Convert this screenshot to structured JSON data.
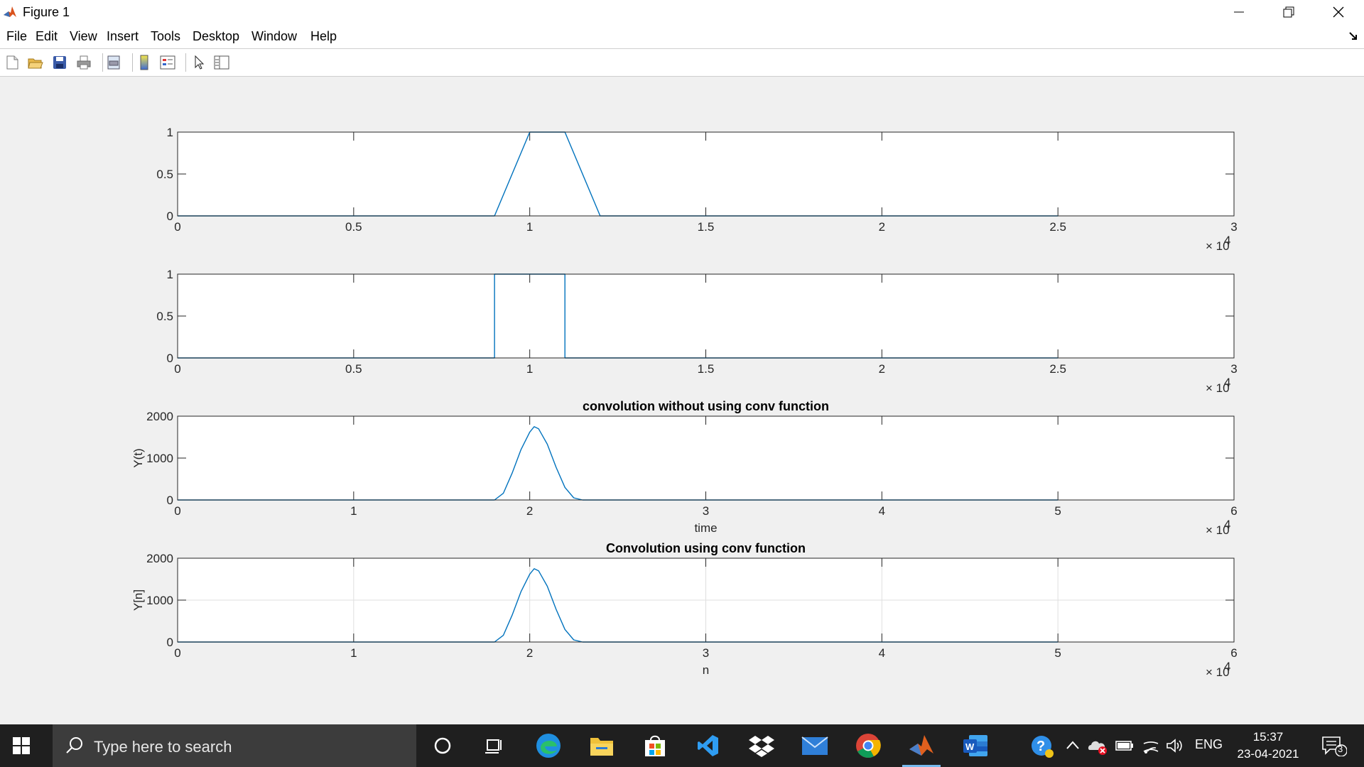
{
  "window": {
    "title": "Figure 1"
  },
  "menu": {
    "items": [
      "File",
      "Edit",
      "View",
      "Insert",
      "Tools",
      "Desktop",
      "Window",
      "Help"
    ]
  },
  "toolbar": {
    "buttons": [
      "new-figure",
      "open-file",
      "save-figure",
      "print-figure",
      "print-preview",
      "insert-colorbar",
      "insert-legend",
      "edit-plot",
      "show-plot-tools"
    ]
  },
  "colors": {
    "line": "#0072bd",
    "taskbar": "#1f1f1f",
    "accent": "#76b9ed"
  },
  "chart_data": [
    {
      "type": "line",
      "title": "",
      "xlabel": "",
      "ylabel": "",
      "xlim": [
        0,
        30000
      ],
      "ylim": [
        0,
        1
      ],
      "xticks": [
        "0",
        "0.5",
        "1",
        "1.5",
        "2",
        "2.5",
        "3"
      ],
      "yticks": [
        "0",
        "0.5",
        "1"
      ],
      "exponent": "× 10",
      "exponent_power": "4",
      "grid": false,
      "series": [
        {
          "x": [
            0,
            9000,
            10000,
            11000,
            12000,
            25000
          ],
          "y": [
            0,
            0,
            1,
            1,
            0,
            0
          ]
        }
      ]
    },
    {
      "type": "line",
      "title": "",
      "xlabel": "",
      "ylabel": "",
      "xlim": [
        0,
        30000
      ],
      "ylim": [
        0,
        1
      ],
      "xticks": [
        "0",
        "0.5",
        "1",
        "1.5",
        "2",
        "2.5",
        "3"
      ],
      "yticks": [
        "0",
        "0.5",
        "1"
      ],
      "exponent": "× 10",
      "exponent_power": "4",
      "grid": false,
      "series": [
        {
          "x": [
            0,
            9000,
            9000,
            11000,
            11000,
            25000
          ],
          "y": [
            0,
            0,
            1,
            1,
            0,
            0
          ]
        }
      ]
    },
    {
      "type": "line",
      "title": "convolution without using conv function",
      "xlabel": "time",
      "ylabel": "Y(t)",
      "xlim": [
        0,
        60000
      ],
      "ylim": [
        0,
        2000
      ],
      "xticks": [
        "0",
        "1",
        "2",
        "3",
        "4",
        "5",
        "6"
      ],
      "yticks": [
        "0",
        "1000",
        "2000"
      ],
      "exponent": "× 10",
      "exponent_power": "4",
      "grid": false,
      "series": [
        {
          "x": [
            0,
            18000,
            18500,
            19000,
            19500,
            20000,
            20250,
            20500,
            21000,
            21500,
            22000,
            22500,
            23000,
            50000
          ],
          "y": [
            0,
            0,
            160,
            640,
            1200,
            1620,
            1750,
            1700,
            1330,
            780,
            300,
            50,
            0,
            0
          ]
        }
      ]
    },
    {
      "type": "line",
      "title": "Convolution using conv function",
      "xlabel": "n",
      "ylabel": "Y[n]",
      "xlim": [
        0,
        60000
      ],
      "ylim": [
        0,
        2000
      ],
      "xticks": [
        "0",
        "1",
        "2",
        "3",
        "4",
        "5",
        "6"
      ],
      "yticks": [
        "0",
        "1000",
        "2000"
      ],
      "exponent": "× 10",
      "exponent_power": "4",
      "grid": true,
      "series": [
        {
          "x": [
            0,
            18000,
            18500,
            19000,
            19500,
            20000,
            20250,
            20500,
            21000,
            21500,
            22000,
            22500,
            23000,
            50000
          ],
          "y": [
            0,
            0,
            160,
            640,
            1200,
            1620,
            1750,
            1700,
            1330,
            780,
            300,
            50,
            0,
            0
          ]
        }
      ]
    }
  ],
  "taskbar": {
    "search_placeholder": "Type here to search",
    "apps": [
      "cortana",
      "task-view",
      "edge",
      "file-explorer",
      "store",
      "visual-studio",
      "dropbox",
      "mail",
      "chrome",
      "matlab",
      "word"
    ],
    "language": "ENG",
    "time": "15:37",
    "date": "23-04-2021",
    "notification_count": "3"
  }
}
